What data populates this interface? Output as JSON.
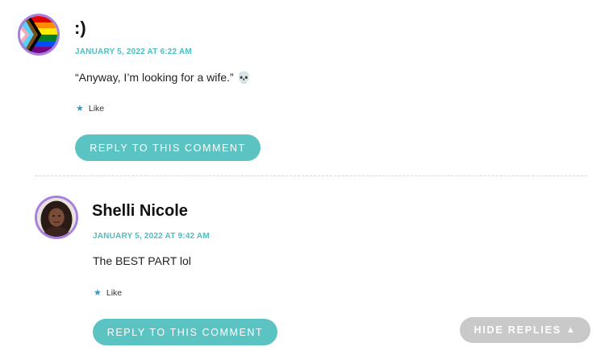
{
  "comments": [
    {
      "author": ":)",
      "date": "JANUARY 5, 2022 AT 6:22 AM",
      "text": "“Anyway, I’m looking for a wife.” 💀",
      "like_label": "Like",
      "reply_label": "REPLY TO THIS COMMENT",
      "avatar_icon": "pride-flag-avatar"
    },
    {
      "author": "Shelli Nicole",
      "date": "JANUARY 5, 2022 AT 9:42 AM",
      "text": "The BEST PART lol",
      "like_label": "Like",
      "reply_label": "REPLY TO THIS COMMENT",
      "avatar_icon": "user-photo-avatar"
    }
  ],
  "hide_replies": {
    "label": "HIDE REPLIES",
    "icon": "triangle-up-icon"
  },
  "colors": {
    "accent": "#5cc3c3",
    "date": "#4cbfc0",
    "avatar_ring": "#a77fe0",
    "like_star": "#3a96c8",
    "hide_button": "#c9c9c9"
  }
}
